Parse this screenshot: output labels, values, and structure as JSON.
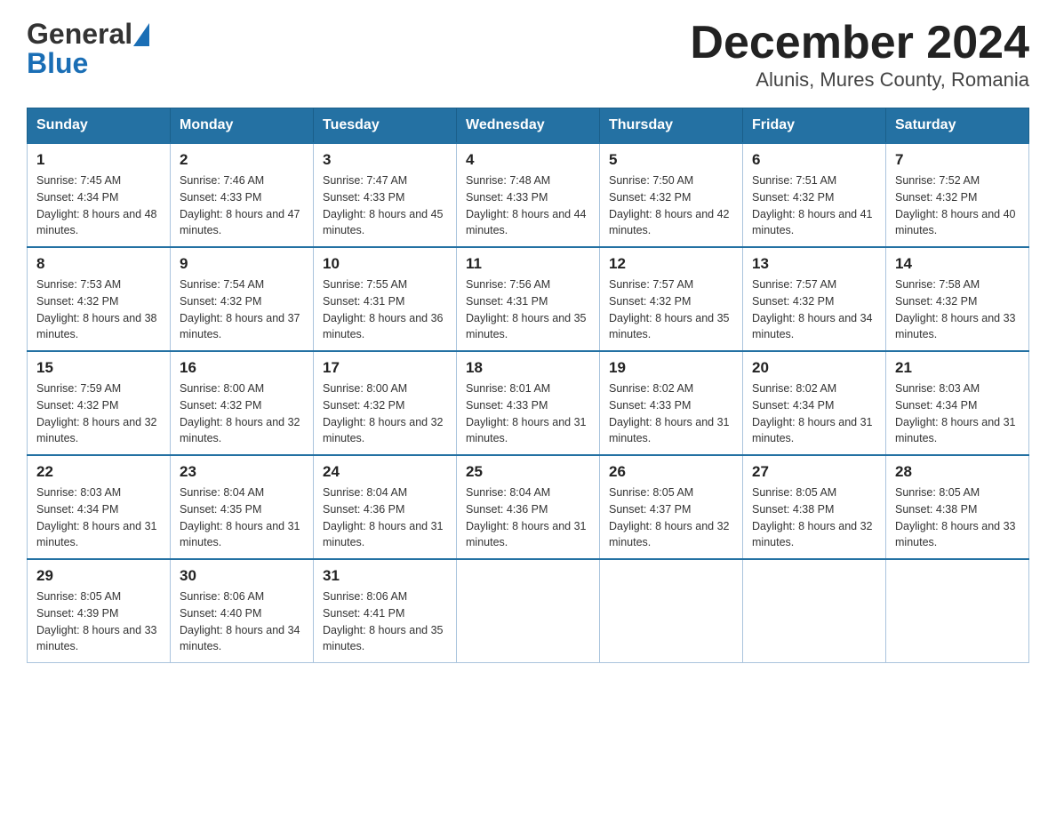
{
  "header": {
    "logo_line1": "General",
    "logo_line2": "Blue",
    "title": "December 2024",
    "subtitle": "Alunis, Mures County, Romania"
  },
  "calendar": {
    "days": [
      "Sunday",
      "Monday",
      "Tuesday",
      "Wednesday",
      "Thursday",
      "Friday",
      "Saturday"
    ],
    "weeks": [
      [
        {
          "day": "1",
          "sunrise": "7:45 AM",
          "sunset": "4:34 PM",
          "daylight": "8 hours and 48 minutes."
        },
        {
          "day": "2",
          "sunrise": "7:46 AM",
          "sunset": "4:33 PM",
          "daylight": "8 hours and 47 minutes."
        },
        {
          "day": "3",
          "sunrise": "7:47 AM",
          "sunset": "4:33 PM",
          "daylight": "8 hours and 45 minutes."
        },
        {
          "day": "4",
          "sunrise": "7:48 AM",
          "sunset": "4:33 PM",
          "daylight": "8 hours and 44 minutes."
        },
        {
          "day": "5",
          "sunrise": "7:50 AM",
          "sunset": "4:32 PM",
          "daylight": "8 hours and 42 minutes."
        },
        {
          "day": "6",
          "sunrise": "7:51 AM",
          "sunset": "4:32 PM",
          "daylight": "8 hours and 41 minutes."
        },
        {
          "day": "7",
          "sunrise": "7:52 AM",
          "sunset": "4:32 PM",
          "daylight": "8 hours and 40 minutes."
        }
      ],
      [
        {
          "day": "8",
          "sunrise": "7:53 AM",
          "sunset": "4:32 PM",
          "daylight": "8 hours and 38 minutes."
        },
        {
          "day": "9",
          "sunrise": "7:54 AM",
          "sunset": "4:32 PM",
          "daylight": "8 hours and 37 minutes."
        },
        {
          "day": "10",
          "sunrise": "7:55 AM",
          "sunset": "4:31 PM",
          "daylight": "8 hours and 36 minutes."
        },
        {
          "day": "11",
          "sunrise": "7:56 AM",
          "sunset": "4:31 PM",
          "daylight": "8 hours and 35 minutes."
        },
        {
          "day": "12",
          "sunrise": "7:57 AM",
          "sunset": "4:32 PM",
          "daylight": "8 hours and 35 minutes."
        },
        {
          "day": "13",
          "sunrise": "7:57 AM",
          "sunset": "4:32 PM",
          "daylight": "8 hours and 34 minutes."
        },
        {
          "day": "14",
          "sunrise": "7:58 AM",
          "sunset": "4:32 PM",
          "daylight": "8 hours and 33 minutes."
        }
      ],
      [
        {
          "day": "15",
          "sunrise": "7:59 AM",
          "sunset": "4:32 PM",
          "daylight": "8 hours and 32 minutes."
        },
        {
          "day": "16",
          "sunrise": "8:00 AM",
          "sunset": "4:32 PM",
          "daylight": "8 hours and 32 minutes."
        },
        {
          "day": "17",
          "sunrise": "8:00 AM",
          "sunset": "4:32 PM",
          "daylight": "8 hours and 32 minutes."
        },
        {
          "day": "18",
          "sunrise": "8:01 AM",
          "sunset": "4:33 PM",
          "daylight": "8 hours and 31 minutes."
        },
        {
          "day": "19",
          "sunrise": "8:02 AM",
          "sunset": "4:33 PM",
          "daylight": "8 hours and 31 minutes."
        },
        {
          "day": "20",
          "sunrise": "8:02 AM",
          "sunset": "4:34 PM",
          "daylight": "8 hours and 31 minutes."
        },
        {
          "day": "21",
          "sunrise": "8:03 AM",
          "sunset": "4:34 PM",
          "daylight": "8 hours and 31 minutes."
        }
      ],
      [
        {
          "day": "22",
          "sunrise": "8:03 AM",
          "sunset": "4:34 PM",
          "daylight": "8 hours and 31 minutes."
        },
        {
          "day": "23",
          "sunrise": "8:04 AM",
          "sunset": "4:35 PM",
          "daylight": "8 hours and 31 minutes."
        },
        {
          "day": "24",
          "sunrise": "8:04 AM",
          "sunset": "4:36 PM",
          "daylight": "8 hours and 31 minutes."
        },
        {
          "day": "25",
          "sunrise": "8:04 AM",
          "sunset": "4:36 PM",
          "daylight": "8 hours and 31 minutes."
        },
        {
          "day": "26",
          "sunrise": "8:05 AM",
          "sunset": "4:37 PM",
          "daylight": "8 hours and 32 minutes."
        },
        {
          "day": "27",
          "sunrise": "8:05 AM",
          "sunset": "4:38 PM",
          "daylight": "8 hours and 32 minutes."
        },
        {
          "day": "28",
          "sunrise": "8:05 AM",
          "sunset": "4:38 PM",
          "daylight": "8 hours and 33 minutes."
        }
      ],
      [
        {
          "day": "29",
          "sunrise": "8:05 AM",
          "sunset": "4:39 PM",
          "daylight": "8 hours and 33 minutes."
        },
        {
          "day": "30",
          "sunrise": "8:06 AM",
          "sunset": "4:40 PM",
          "daylight": "8 hours and 34 minutes."
        },
        {
          "day": "31",
          "sunrise": "8:06 AM",
          "sunset": "4:41 PM",
          "daylight": "8 hours and 35 minutes."
        },
        null,
        null,
        null,
        null
      ]
    ],
    "sunrise_label": "Sunrise:",
    "sunset_label": "Sunset:",
    "daylight_label": "Daylight:"
  }
}
